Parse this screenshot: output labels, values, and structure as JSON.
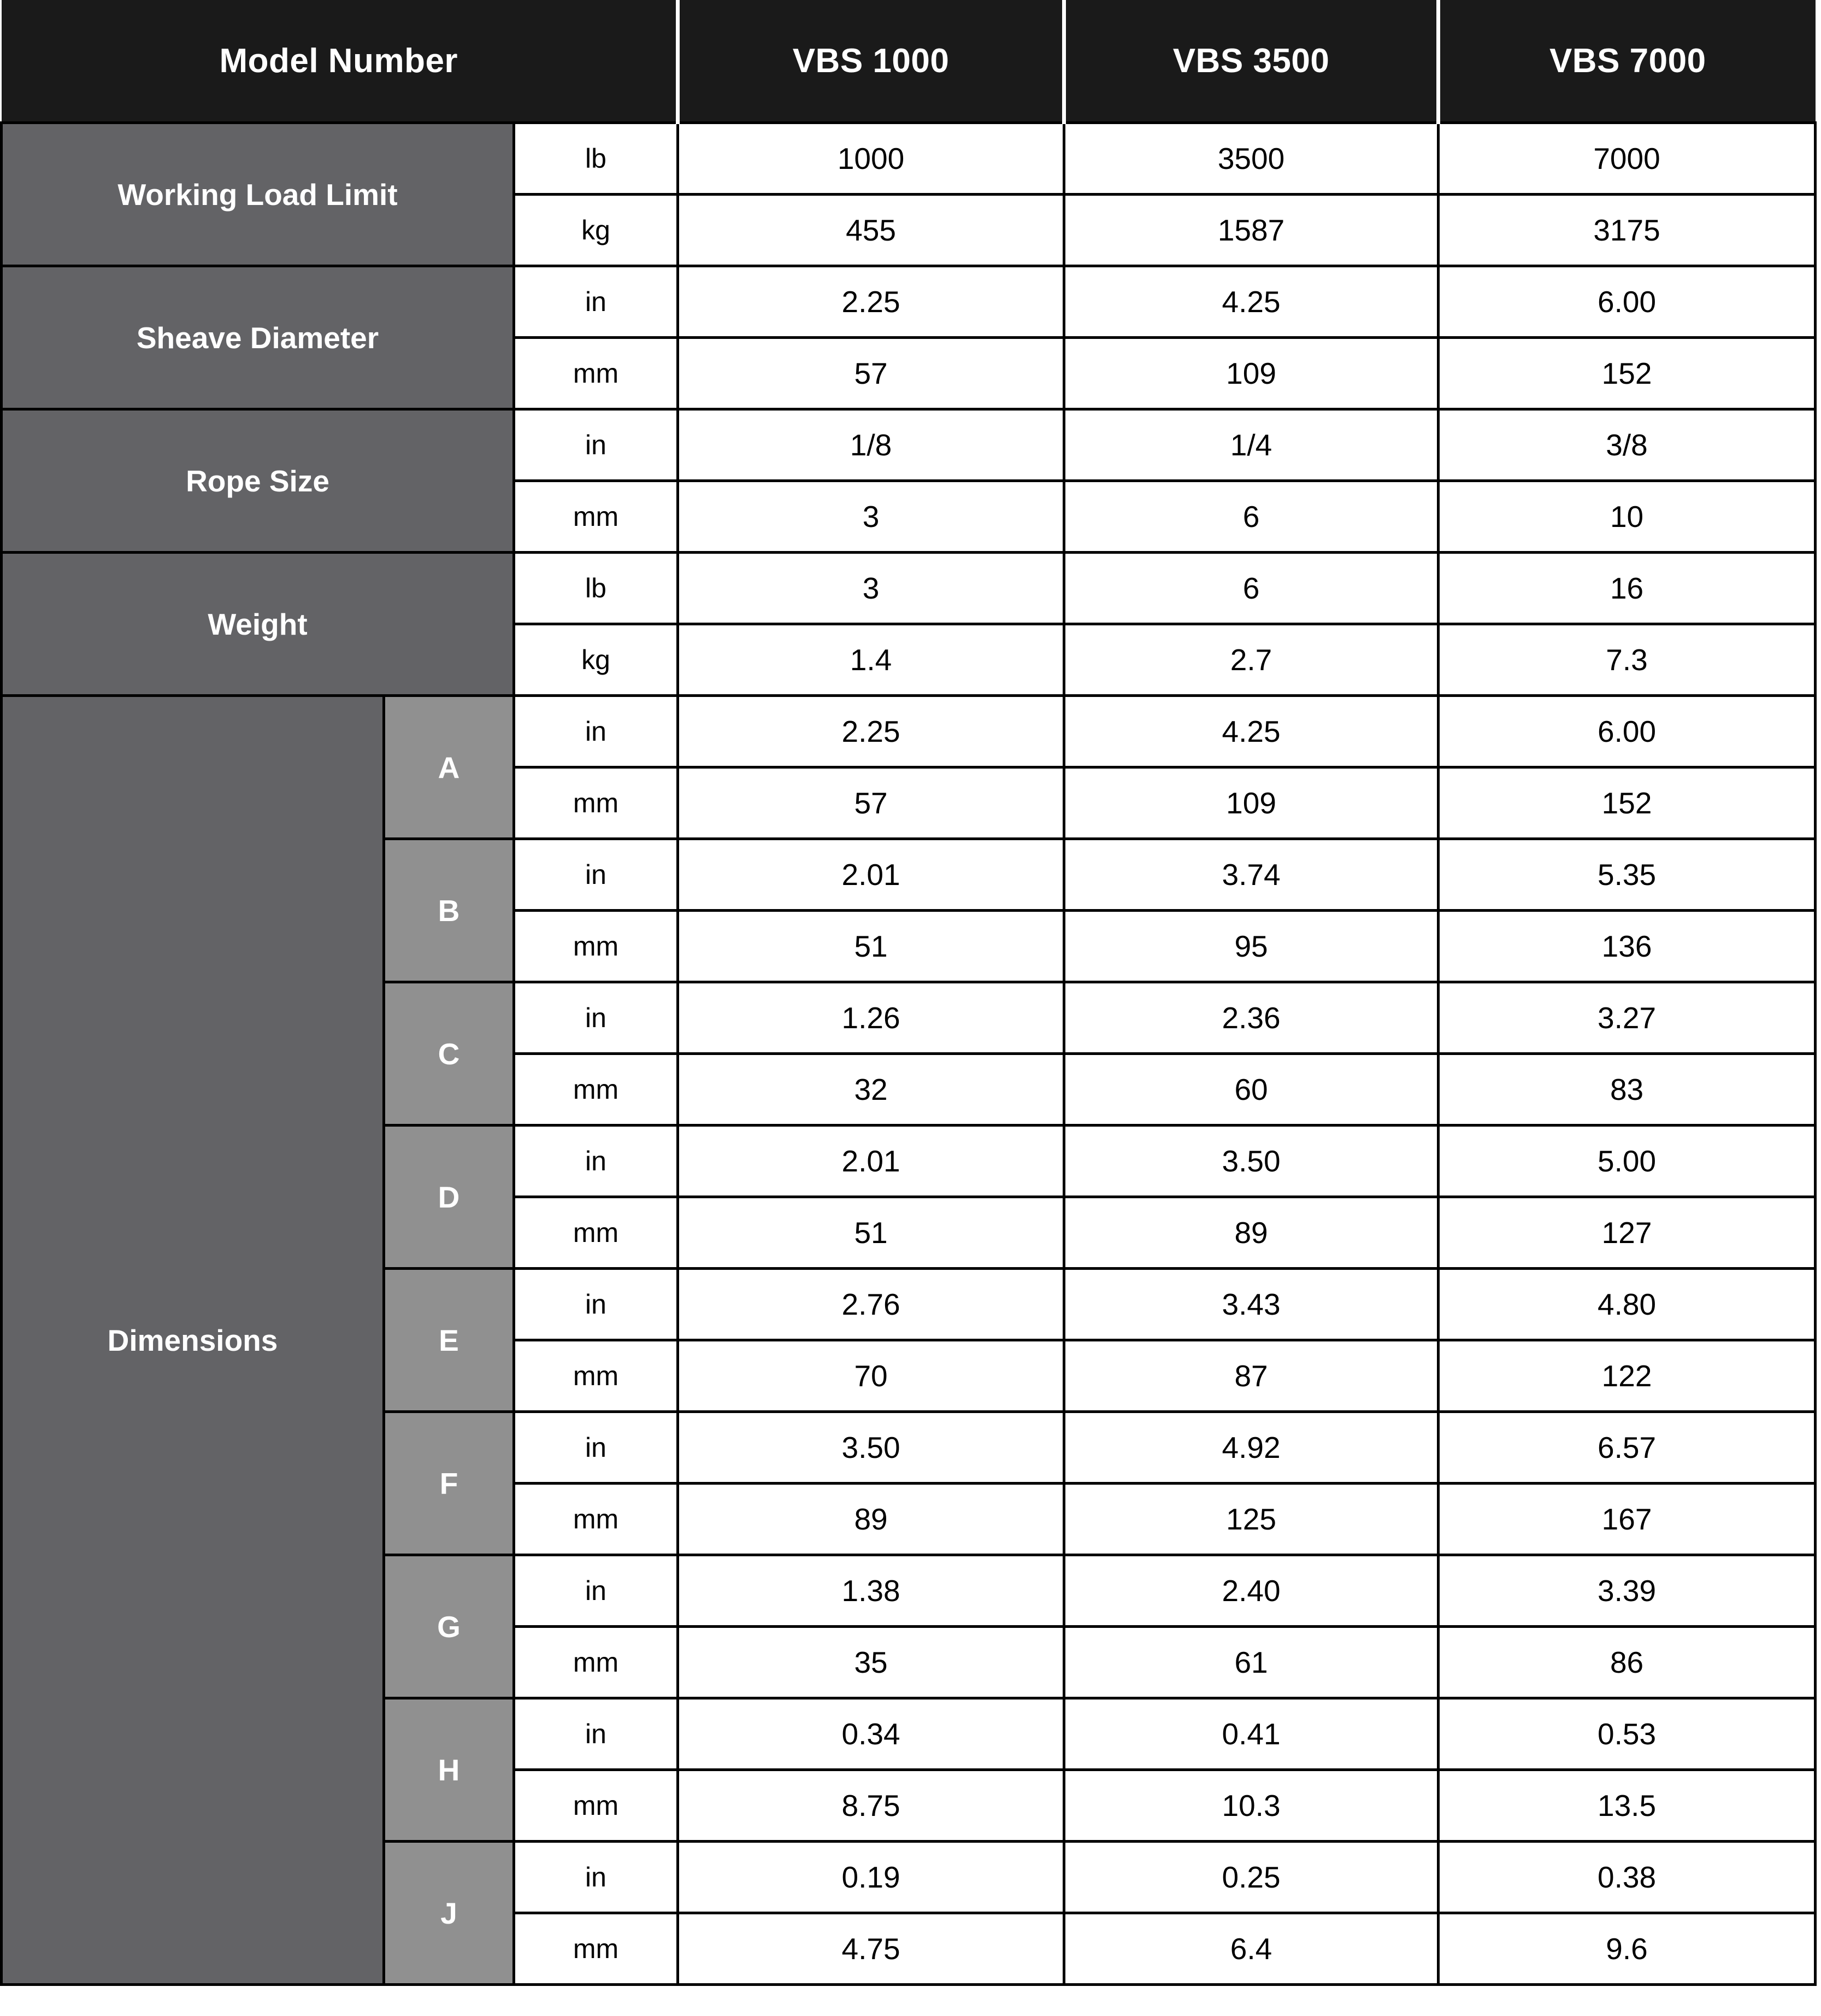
{
  "table": {
    "header": {
      "row_label": "Model Number",
      "models": [
        "VBS 1000",
        "VBS 3500",
        "VBS 7000"
      ]
    },
    "sections": [
      {
        "label": "Working Load Limit",
        "rows": [
          {
            "unit": "lb",
            "values": [
              "1000",
              "3500",
              "7000"
            ]
          },
          {
            "unit": "kg",
            "values": [
              "455",
              "1587",
              "3175"
            ]
          }
        ]
      },
      {
        "label": "Sheave Diameter",
        "rows": [
          {
            "unit": "in",
            "values": [
              "2.25",
              "4.25",
              "6.00"
            ]
          },
          {
            "unit": "mm",
            "values": [
              "57",
              "109",
              "152"
            ]
          }
        ]
      },
      {
        "label": "Rope Size",
        "rows": [
          {
            "unit": "in",
            "values": [
              "1/8",
              "1/4",
              "3/8"
            ]
          },
          {
            "unit": "mm",
            "values": [
              "3",
              "6",
              "10"
            ]
          }
        ]
      },
      {
        "label": "Weight",
        "rows": [
          {
            "unit": "lb",
            "values": [
              "3",
              "6",
              "16"
            ]
          },
          {
            "unit": "kg",
            "values": [
              "1.4",
              "2.7",
              "7.3"
            ]
          }
        ]
      }
    ],
    "dimensions": {
      "label": "Dimensions",
      "groups": [
        {
          "letter": "A",
          "rows": [
            {
              "unit": "in",
              "values": [
                "2.25",
                "4.25",
                "6.00"
              ]
            },
            {
              "unit": "mm",
              "values": [
                "57",
                "109",
                "152"
              ]
            }
          ]
        },
        {
          "letter": "B",
          "rows": [
            {
              "unit": "in",
              "values": [
                "2.01",
                "3.74",
                "5.35"
              ]
            },
            {
              "unit": "mm",
              "values": [
                "51",
                "95",
                "136"
              ]
            }
          ]
        },
        {
          "letter": "C",
          "rows": [
            {
              "unit": "in",
              "values": [
                "1.26",
                "2.36",
                "3.27"
              ]
            },
            {
              "unit": "mm",
              "values": [
                "32",
                "60",
                "83"
              ]
            }
          ]
        },
        {
          "letter": "D",
          "rows": [
            {
              "unit": "in",
              "values": [
                "2.01",
                "3.50",
                "5.00"
              ]
            },
            {
              "unit": "mm",
              "values": [
                "51",
                "89",
                "127"
              ]
            }
          ]
        },
        {
          "letter": "E",
          "rows": [
            {
              "unit": "in",
              "values": [
                "2.76",
                "3.43",
                "4.80"
              ]
            },
            {
              "unit": "mm",
              "values": [
                "70",
                "87",
                "122"
              ]
            }
          ]
        },
        {
          "letter": "F",
          "rows": [
            {
              "unit": "in",
              "values": [
                "3.50",
                "4.92",
                "6.57"
              ]
            },
            {
              "unit": "mm",
              "values": [
                "89",
                "125",
                "167"
              ]
            }
          ]
        },
        {
          "letter": "G",
          "rows": [
            {
              "unit": "in",
              "values": [
                "1.38",
                "2.40",
                "3.39"
              ]
            },
            {
              "unit": "mm",
              "values": [
                "35",
                "61",
                "86"
              ]
            }
          ]
        },
        {
          "letter": "H",
          "rows": [
            {
              "unit": "in",
              "values": [
                "0.34",
                "0.41",
                "0.53"
              ]
            },
            {
              "unit": "mm",
              "values": [
                "8.75",
                "10.3",
                "13.5"
              ]
            }
          ]
        },
        {
          "letter": "J",
          "rows": [
            {
              "unit": "in",
              "values": [
                "0.19",
                "0.25",
                "0.38"
              ]
            },
            {
              "unit": "mm",
              "values": [
                "4.75",
                "6.4",
                "9.6"
              ]
            }
          ]
        }
      ]
    },
    "colors": {
      "header_bg": "#1a1a1a",
      "label_bg": "#636366",
      "letter_bg": "#909090",
      "cell_bg": "#ffffff",
      "border": "#000000",
      "label_text": "#ffffff",
      "cell_text": "#000000"
    }
  }
}
